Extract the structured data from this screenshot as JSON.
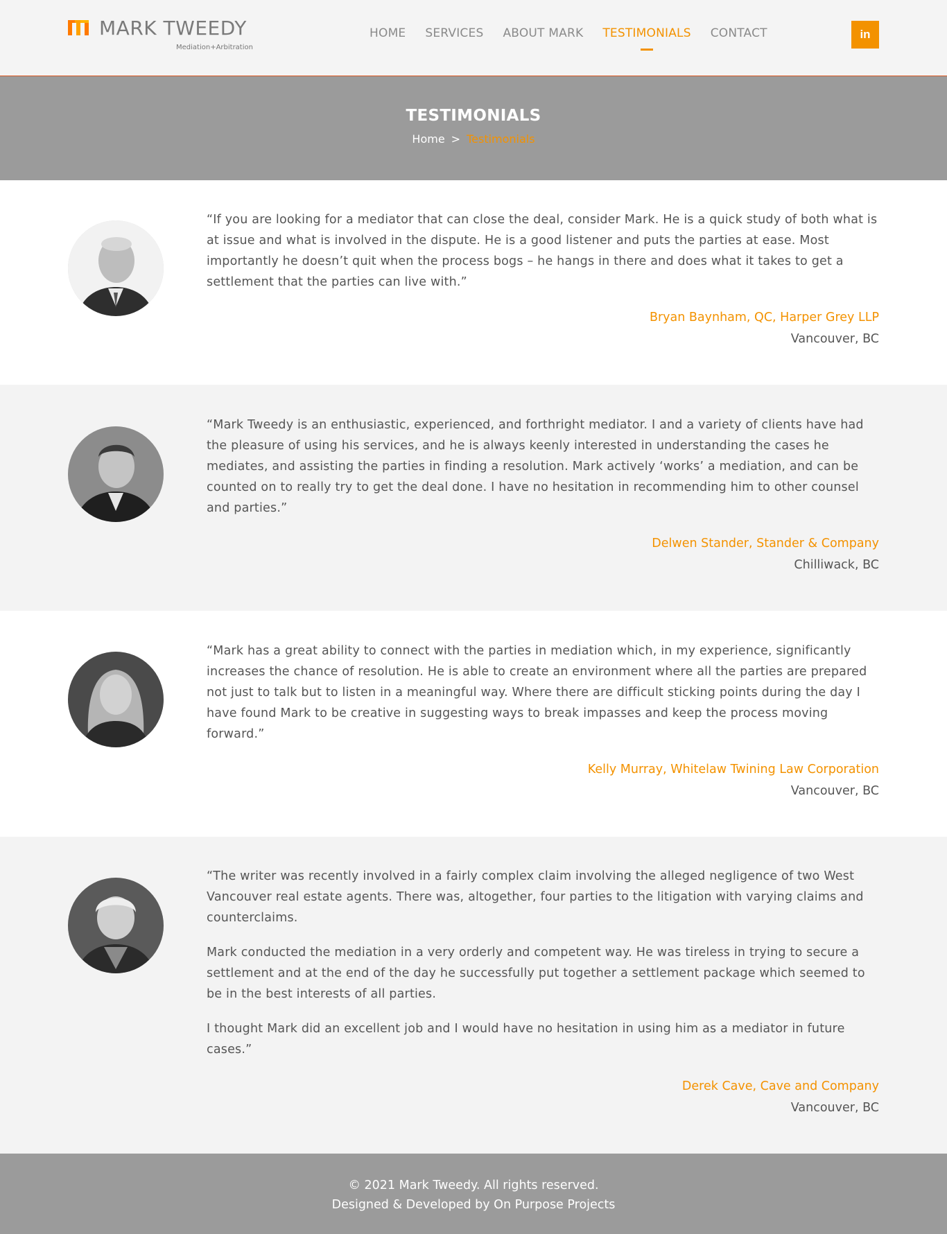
{
  "brand": {
    "name": "MARK TWEEDY",
    "tagline": "Mediation+Arbitration"
  },
  "nav": {
    "items": [
      {
        "label": "HOME"
      },
      {
        "label": "SERVICES"
      },
      {
        "label": "ABOUT MARK"
      },
      {
        "label": "TESTIMONIALS",
        "active": true
      },
      {
        "label": "CONTACT"
      }
    ],
    "linkedin_label": "in"
  },
  "banner": {
    "title": "TESTIMONIALS",
    "breadcrumb": {
      "home": "Home",
      "separator": ">",
      "current": "Testimonials"
    }
  },
  "testimonials": [
    {
      "paragraphs": [
        "“If you are looking for a mediator that can close the deal, consider Mark. He is a quick study of both what is at issue and what is involved in the dispute. He is a good listener and puts the parties at ease. Most importantly he doesn’t quit when the process bogs – he hangs in there and does what it takes to get a settlement that the parties can live with.”"
      ],
      "author": "Bryan Baynham, QC, Harper Grey LLP",
      "location": "Vancouver, BC"
    },
    {
      "paragraphs": [
        "“Mark Tweedy is an enthusiastic, experienced, and forthright mediator. I and a variety of clients have had the pleasure of using his services, and he is always keenly interested in understanding the cases he mediates, and assisting the parties in finding a resolution. Mark actively ‘works’ a mediation, and can be counted on to really try to get the deal done. I have no hesitation in recommending him to other counsel and parties.”"
      ],
      "author": "Delwen Stander, Stander & Company",
      "location": "Chilliwack, BC"
    },
    {
      "paragraphs": [
        "“Mark has a great ability to connect with the parties in mediation which, in my experience, significantly increases the chance of resolution. He is able to create an environment where all the parties are prepared not just to talk but to listen in a meaningful way. Where there are difficult sticking points during the day I have found Mark to be creative in suggesting ways to break impasses and keep the process moving forward.”"
      ],
      "author": "Kelly Murray, Whitelaw Twining Law Corporation",
      "location": "Vancouver, BC"
    },
    {
      "paragraphs": [
        "“The writer was recently involved in a fairly complex claim involving the alleged negligence of two West Vancouver real estate agents. There was, altogether, four parties to the litigation with varying claims and counterclaims.",
        "Mark conducted the mediation in a very orderly and competent way. He was tireless in trying to secure a settlement and at the end of the day he successfully put together a settlement package which seemed to be in the best interests of all parties.",
        "I thought Mark did an excellent job and I would have no hesitation in using him as a mediator in future cases.”"
      ],
      "author": "Derek Cave, Cave and Company",
      "location": "Vancouver, BC"
    }
  ],
  "footer": {
    "copyright": "© 2021 Mark Tweedy. All rights reserved.",
    "credit": "Designed & Developed by On Purpose Projects"
  },
  "colors": {
    "accent": "#f39200",
    "banner": "#9b9b9b",
    "header_bg": "#f4f4f4",
    "alt_bg": "#f3f3f3"
  }
}
